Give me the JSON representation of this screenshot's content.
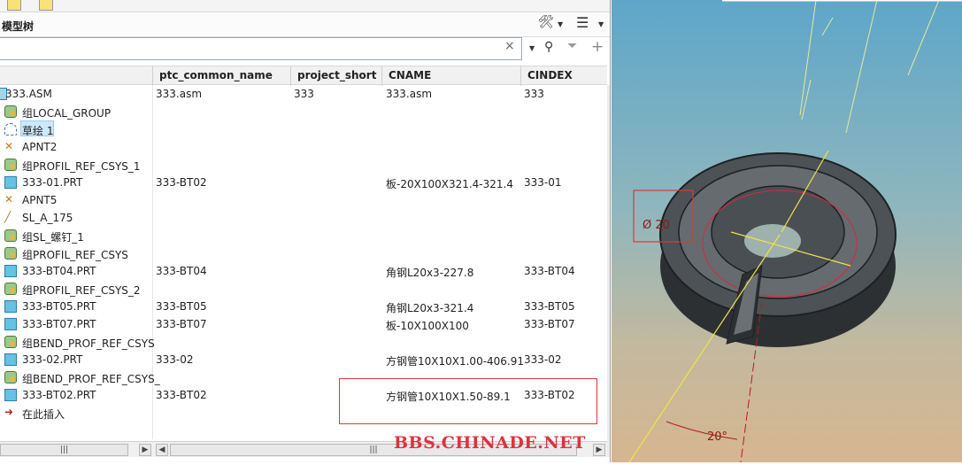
{
  "panel": {
    "title": "模型树"
  },
  "filter": {
    "value": "",
    "clear_symbol": "×"
  },
  "columns": [
    "ptc_common_name",
    "project_short",
    "CNAME",
    "CINDEX"
  ],
  "rows": [
    {
      "name": "333.ASM",
      "icon": "assembly-icon",
      "common": "333.asm",
      "short": "333",
      "cname": "333.asm",
      "cindex": "333"
    },
    {
      "name": "组LOCAL_GROUP",
      "icon": "group-icon",
      "common": "",
      "short": "",
      "cname": "",
      "cindex": ""
    },
    {
      "name": "草绘 1",
      "icon": "sketch-icon",
      "common": "",
      "short": "",
      "cname": "",
      "cindex": ""
    },
    {
      "name": "APNT2",
      "icon": "datum-point-icon",
      "common": "",
      "short": "",
      "cname": "",
      "cindex": ""
    },
    {
      "name": "组PROFIL_REF_CSYS_1",
      "icon": "group-icon",
      "common": "",
      "short": "",
      "cname": "",
      "cindex": ""
    },
    {
      "name": "333-01.PRT",
      "icon": "part-icon",
      "common": "333-BT02",
      "short": "",
      "cname": "板-20X100X321.4-321.4",
      "cindex": "333-01"
    },
    {
      "name": "APNT5",
      "icon": "datum-point-icon",
      "common": "",
      "short": "",
      "cname": "",
      "cindex": ""
    },
    {
      "name": "SL_A_175",
      "icon": "curve-icon",
      "common": "",
      "short": "",
      "cname": "",
      "cindex": ""
    },
    {
      "name": "组SL_螺钉_1",
      "icon": "group-icon",
      "common": "",
      "short": "",
      "cname": "",
      "cindex": ""
    },
    {
      "name": "组PROFIL_REF_CSYS",
      "icon": "group-icon",
      "common": "",
      "short": "",
      "cname": "",
      "cindex": ""
    },
    {
      "name": "333-BT04.PRT",
      "icon": "part-icon",
      "common": "333-BT04",
      "short": "",
      "cname": "角钢L20x3-227.8",
      "cindex": "333-BT04"
    },
    {
      "name": "组PROFIL_REF_CSYS_2",
      "icon": "group-icon",
      "common": "",
      "short": "",
      "cname": "",
      "cindex": ""
    },
    {
      "name": "333-BT05.PRT",
      "icon": "part-icon",
      "common": "333-BT05",
      "short": "",
      "cname": "角钢L20x3-321.4",
      "cindex": "333-BT05"
    },
    {
      "name": "333-BT07.PRT",
      "icon": "part-icon",
      "common": "333-BT07",
      "short": "",
      "cname": "板-10X100X100",
      "cindex": "333-BT07"
    },
    {
      "name": "组BEND_PROF_REF_CSYS",
      "icon": "group-icon",
      "common": "",
      "short": "",
      "cname": "",
      "cindex": ""
    },
    {
      "name": "333-02.PRT",
      "icon": "part-icon",
      "common": "333-02",
      "short": "",
      "cname": "方钢管10X10X1.00-406.91",
      "cindex": "333-02"
    },
    {
      "name": "组BEND_PROF_REF_CSYS_",
      "icon": "group-icon",
      "common": "",
      "short": "",
      "cname": "",
      "cindex": ""
    },
    {
      "name": "333-BT02.PRT",
      "icon": "part-icon",
      "common": "333-BT02",
      "short": "",
      "cname": "方钢管10X10X1.50-89.1",
      "cindex": "333-BT02"
    },
    {
      "name": "在此插入",
      "icon": "insert-here-icon",
      "common": "",
      "short": "",
      "cname": "",
      "cindex": ""
    }
  ],
  "viewport": {
    "dimension_diameter": "Ø 20",
    "angle_label": "20°"
  },
  "watermark": "BBS.CHINADE.NET",
  "colors": {
    "highlight": "#d83a3a",
    "selection": "#cde8fb",
    "model": "#3f4347"
  }
}
